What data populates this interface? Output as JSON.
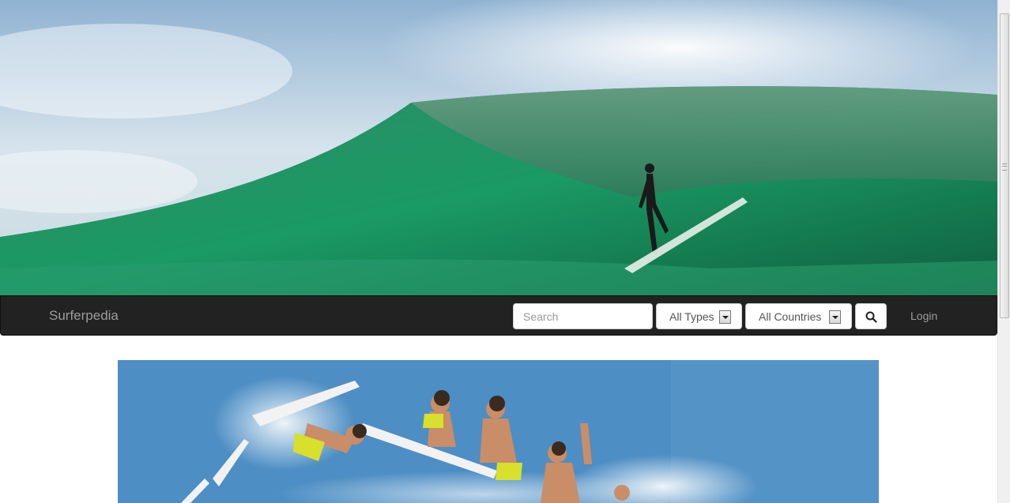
{
  "navbar": {
    "brand": "Surferpedia",
    "search_placeholder": "Search",
    "type_select": {
      "selected": "All Types"
    },
    "country_select": {
      "selected": "All Countries"
    },
    "login_label": "Login"
  },
  "images": {
    "hero": "surfer-riding-green-wave-photo",
    "feature": "surfer-aerial-sequence-photo"
  },
  "colors": {
    "navbar_bg": "#222222",
    "navbar_text": "#9d9d9d"
  }
}
